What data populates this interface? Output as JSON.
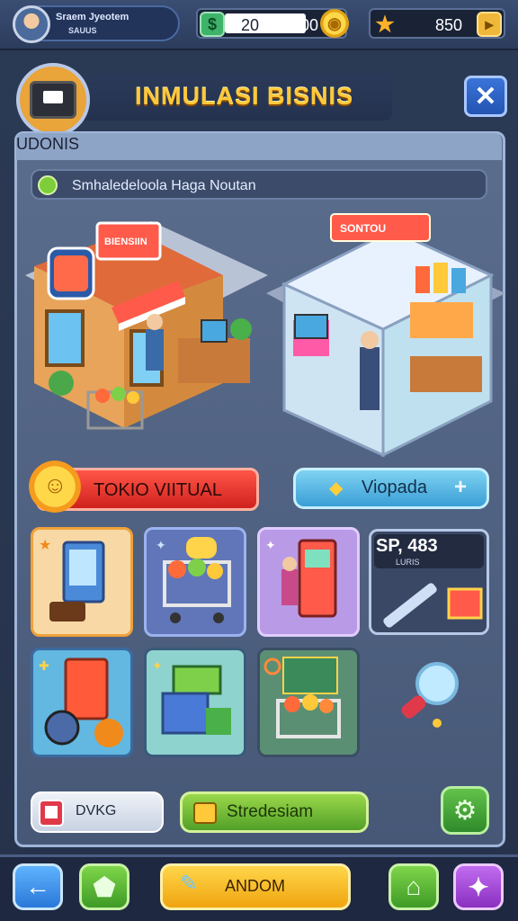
{
  "topbar": {
    "profile_name": "Sraem  Jyeotem",
    "profile_sub": "SAUUS",
    "money_left": "20",
    "money_right": "100",
    "stars": "850"
  },
  "title": "INMULASI  BISNIS",
  "panel": {
    "header": "UDONIS",
    "search_text": "Smhaledeloola Haga Noutan",
    "store_sign": "BIENSIIN",
    "mall_sign": "SONTOU"
  },
  "actions": {
    "red_label": "TOKIO VIITUAL",
    "blue_label": "Viopada"
  },
  "stat": {
    "value": "SP, 483",
    "sub": "LURIS"
  },
  "bottom_row": {
    "pill_label": "DVKG",
    "green_label": "Stredesiam"
  },
  "nav": {
    "main_label": "ANDOM"
  },
  "colors": {
    "title_gold": "#ffc93a",
    "red_button": "#e0302a",
    "blue_button": "#4fb4e2",
    "green_button": "#6cbc34"
  }
}
